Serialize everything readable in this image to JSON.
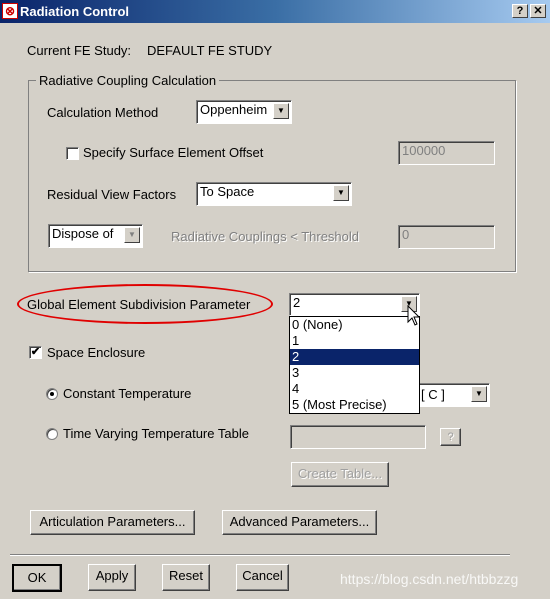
{
  "window": {
    "title": "Radiation Control",
    "help_label": "?",
    "close_label": "✕",
    "icon": "radiation-app-icon"
  },
  "study": {
    "label": "Current FE Study:",
    "value": "DEFAULT FE STUDY"
  },
  "coupling": {
    "title": "Radiative Coupling Calculation",
    "method_label": "Calculation Method",
    "method_value": "Oppenheim",
    "offset_label": "Specify Surface Element Offset",
    "offset_checked": false,
    "offset_value": "100000",
    "residual_label": "Residual View Factors",
    "residual_value": "To Space",
    "dispose_value": "Dispose of",
    "threshold_label": "Radiative Couplings < Threshold",
    "threshold_value": "0"
  },
  "subdivision": {
    "label": "Global Element Subdivision Parameter",
    "value": "2",
    "options": [
      "0 (None)",
      "1",
      "2",
      "3",
      "4",
      "5 (Most Precise)"
    ],
    "selected_index": 2,
    "highlight_color": "#0a246a"
  },
  "enclosure": {
    "label": "Space Enclosure",
    "checked": true,
    "constant_label": "Constant Temperature",
    "constant_selected": true,
    "temp_unit_value": "[ C ]",
    "varying_label": "Time Varying Temperature Table",
    "varying_selected": false,
    "help_label": "?",
    "create_table_label": "Create Table..."
  },
  "buttons": {
    "articulation": "Articulation Parameters...",
    "advanced": "Advanced Parameters...",
    "ok": "OK",
    "apply": "Apply",
    "reset": "Reset",
    "cancel": "Cancel"
  },
  "watermark": "https://blog.csdn.net/htbbzzg",
  "annotation_color": "#e00000"
}
